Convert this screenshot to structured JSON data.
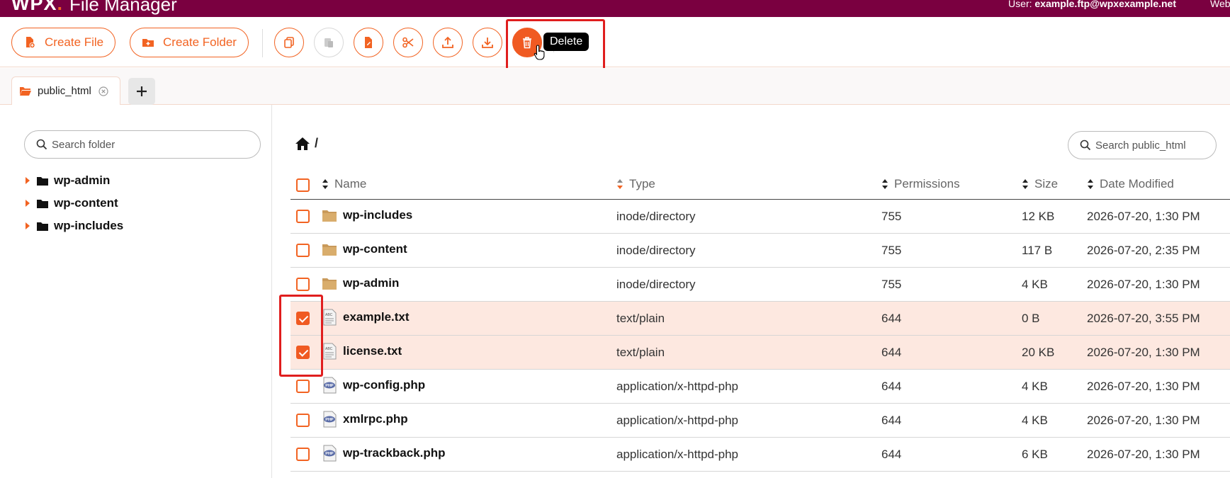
{
  "app": {
    "logo": "WPX",
    "logo_dot": ".",
    "title": "File Manager",
    "user_label": "User:",
    "user_email": "example.ftp@wpxexample.net",
    "website_link": "Website"
  },
  "toolbar": {
    "create_file": "Create File",
    "create_folder": "Create Folder",
    "tooltip": "Delete"
  },
  "tabs": [
    {
      "label": "public_html"
    }
  ],
  "sidebar": {
    "search_placeholder": "Search folder",
    "tree": [
      {
        "label": "wp-admin"
      },
      {
        "label": "wp-content"
      },
      {
        "label": "wp-includes"
      }
    ]
  },
  "main": {
    "breadcrumb": "/",
    "search_placeholder": "Search public_html",
    "columns": {
      "name": "Name",
      "type": "Type",
      "permissions": "Permissions",
      "size": "Size",
      "date": "Date Modified"
    },
    "rows": [
      {
        "name": "wp-includes",
        "type": "inode/directory",
        "perm": "755",
        "size": "12 KB",
        "date": "2026-07-20, 1:30 PM",
        "icon": "folder-icon",
        "checked": false
      },
      {
        "name": "wp-content",
        "type": "inode/directory",
        "perm": "755",
        "size": "117 B",
        "date": "2026-07-20, 2:35 PM",
        "icon": "folder-icon",
        "checked": false
      },
      {
        "name": "wp-admin",
        "type": "inode/directory",
        "perm": "755",
        "size": "4 KB",
        "date": "2026-07-20, 1:30 PM",
        "icon": "folder-icon",
        "checked": false
      },
      {
        "name": "example.txt",
        "type": "text/plain",
        "perm": "644",
        "size": "0 B",
        "date": "2026-07-20, 3:55 PM",
        "icon": "text-file-icon",
        "checked": true
      },
      {
        "name": "license.txt",
        "type": "text/plain",
        "perm": "644",
        "size": "20 KB",
        "date": "2026-07-20, 1:30 PM",
        "icon": "text-file-icon",
        "checked": true
      },
      {
        "name": "wp-config.php",
        "type": "application/x-httpd-php",
        "perm": "644",
        "size": "4 KB",
        "date": "2026-07-20, 1:30 PM",
        "icon": "php-file-icon",
        "checked": false
      },
      {
        "name": "xmlrpc.php",
        "type": "application/x-httpd-php",
        "perm": "644",
        "size": "4 KB",
        "date": "2026-07-20, 1:30 PM",
        "icon": "php-file-icon",
        "checked": false
      },
      {
        "name": "wp-trackback.php",
        "type": "application/x-httpd-php",
        "perm": "644",
        "size": "6 KB",
        "date": "2026-07-20, 1:30 PM",
        "icon": "php-file-icon",
        "checked": false
      }
    ]
  },
  "colors": {
    "brand": "#7a0040",
    "accent": "#f26322",
    "selected_row": "#fde8e0",
    "highlight": "#e01e1e"
  }
}
